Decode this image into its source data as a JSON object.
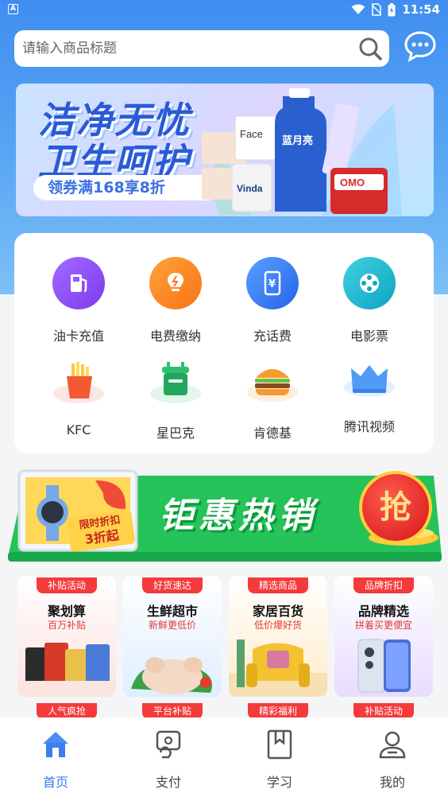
{
  "status_bar": {
    "time": "11:54",
    "app_indicator": "A"
  },
  "search": {
    "placeholder": "请输入商品标题"
  },
  "banner": {
    "line1": "洁净无忧",
    "line2": "卫生呵护",
    "promo": "领券满168享8折",
    "brand_face": "Face",
    "brand_bluemoon": "蓝月亮",
    "brand_vinda": "Vinda",
    "brand_omo": "OMO"
  },
  "services": [
    {
      "label": "油卡充值",
      "icon": "fuel-pump-icon",
      "color": "#8b5cf6"
    },
    {
      "label": "电费缴纳",
      "icon": "lightbulb-icon",
      "color": "#f97316"
    },
    {
      "label": "充话费",
      "icon": "phone-yuan-icon",
      "color": "#3b82f6"
    },
    {
      "label": "电影票",
      "icon": "film-reel-icon",
      "color": "#22b8cf"
    },
    {
      "label": "KFC",
      "icon": "fries-icon"
    },
    {
      "label": "星巴克",
      "icon": "coffee-box-icon"
    },
    {
      "label": "肯德基",
      "icon": "burger-icon"
    },
    {
      "label": "腾讯视频",
      "icon": "crown-icon"
    }
  ],
  "hot_banner": {
    "title": "钜惠热销",
    "tag_line1": "限时折扣",
    "tag_line2": "3折起",
    "grab": "抢"
  },
  "promos": [
    {
      "badge": "补贴活动",
      "title": "聚划算",
      "subtitle": "百万补贴",
      "bg": "#fdecea"
    },
    {
      "badge": "好货速达",
      "title": "生鲜超市",
      "subtitle": "新鲜更低价",
      "bg": "#e7f1ff"
    },
    {
      "badge": "精选商品",
      "title": "家居百货",
      "subtitle": "低价爆好货",
      "bg": "#fff3dc"
    },
    {
      "badge": "品牌折扣",
      "title": "品牌精选",
      "subtitle": "拼着买更便宜",
      "bg": "#efe6ff"
    }
  ],
  "promos_row2": [
    {
      "badge": "人气疯抢"
    },
    {
      "badge": "平台补贴"
    },
    {
      "badge": "精彩福利"
    },
    {
      "badge": "补贴活动"
    }
  ],
  "tabs": [
    {
      "label": "首页",
      "icon": "home-icon",
      "active": true
    },
    {
      "label": "支付",
      "icon": "payment-icon",
      "active": false
    },
    {
      "label": "学习",
      "icon": "bookmark-book-icon",
      "active": false
    },
    {
      "label": "我的",
      "icon": "user-icon",
      "active": false
    }
  ],
  "colors": {
    "accent": "#3a7ef0",
    "header_gradient_top": "#3f8df0",
    "badge_red": "#f43a3a",
    "hot_green": "#22c55e"
  }
}
